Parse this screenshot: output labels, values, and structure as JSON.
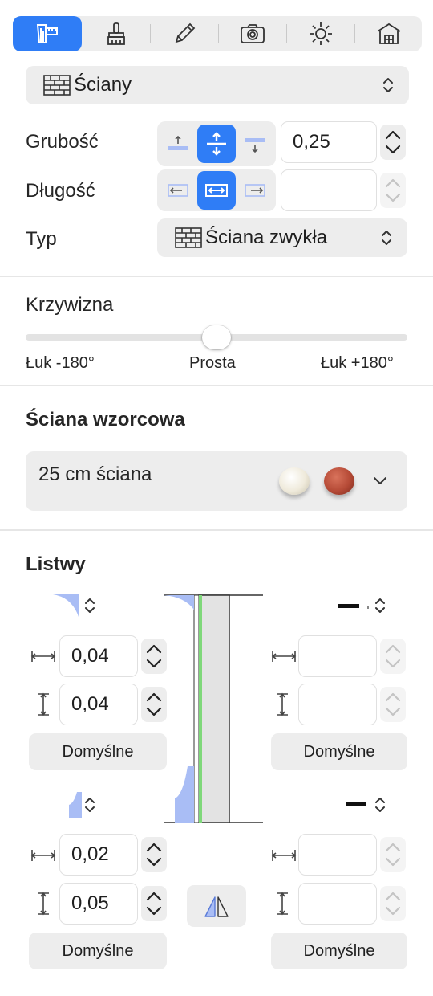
{
  "toolbar": {
    "tabs": [
      {
        "name": "construction-tab",
        "icon": "ruler-building-icon",
        "active": true
      },
      {
        "name": "paint-tab",
        "icon": "paint-brush-icon",
        "active": false
      },
      {
        "name": "pencil-tab",
        "icon": "pencil-icon",
        "active": false
      },
      {
        "name": "camera-tab",
        "icon": "camera-icon",
        "active": false
      },
      {
        "name": "light-tab",
        "icon": "sun-icon",
        "active": false
      },
      {
        "name": "building-tab",
        "icon": "house-icon",
        "active": false
      }
    ]
  },
  "category": {
    "selected": "Ściany",
    "icon": "brick-wall-icon"
  },
  "thickness": {
    "label": "Grubość",
    "value": "0,25"
  },
  "length": {
    "label": "Długość",
    "value": ""
  },
  "type": {
    "label": "Typ",
    "selected": "Ściana zwykła",
    "icon": "brick-wall-icon"
  },
  "curvature": {
    "label": "Krzywizna",
    "min_label": "Łuk -180°",
    "mid_label": "Prosta",
    "max_label": "Łuk +180°",
    "value": 0,
    "range": [
      -180,
      180
    ]
  },
  "template_wall": {
    "heading": "Ściana wzorcowa",
    "selected": "25 cm ściana",
    "material_colors": [
      "#efeadb",
      "#b54a36"
    ]
  },
  "moldings": {
    "heading": "Listwy",
    "top_left": {
      "width": "0,04",
      "height": "0,04",
      "default_label": "Domyślne"
    },
    "top_right": {
      "width": "",
      "height": "",
      "default_label": "Domyślne"
    },
    "bottom_left": {
      "width": "0,02",
      "height": "0,05",
      "default_label": "Domyślne"
    },
    "bottom_right": {
      "width": "",
      "height": "",
      "default_label": "Domyślne"
    }
  },
  "colors": {
    "accent": "#2f7df6",
    "profile": "#a9bdf5",
    "profile_green": "#7fd87a"
  }
}
